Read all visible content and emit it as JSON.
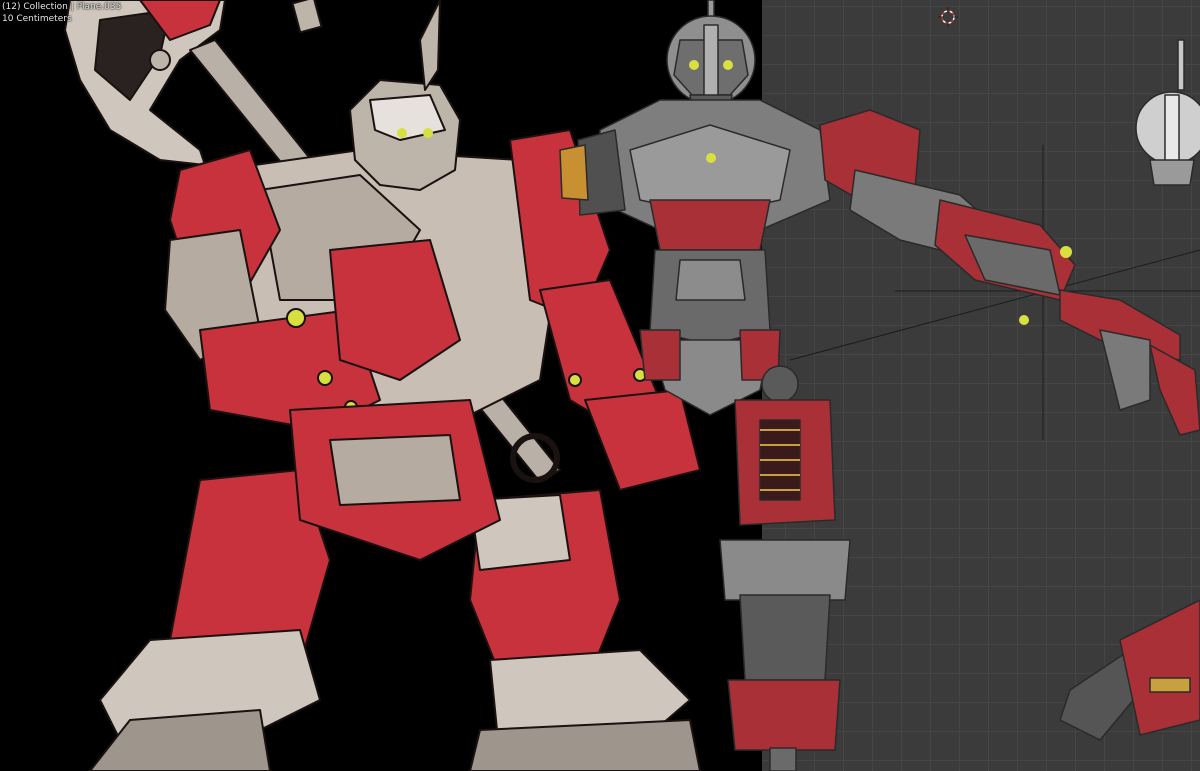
{
  "viewport": {
    "collection_info": "(12) Collection | Plane.035",
    "scale_info": "10 Centimeters"
  },
  "scene": {
    "left_subject": "concept-art-robot-illustration",
    "right_subject": "3d-robot-model",
    "background_left": "#000000",
    "background_grid": "#3b3b3b",
    "accent_red": "#c8323c",
    "metal_grey": "#8a8a8a",
    "eye_glow": "#d8e040"
  }
}
